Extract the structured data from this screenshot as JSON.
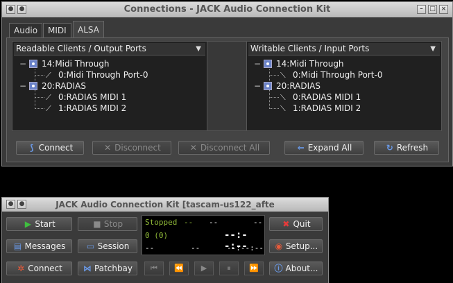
{
  "connections_window": {
    "title": "Connections - JACK Audio Connection Kit",
    "tabs": [
      {
        "label": "Audio"
      },
      {
        "label": "MIDI"
      },
      {
        "label": "ALSA"
      }
    ],
    "readable": {
      "header": "Readable Clients / Output Ports",
      "clients": [
        {
          "label": "14:Midi Through",
          "ports": [
            "0:Midi Through Port-0"
          ]
        },
        {
          "label": "20:RADIAS",
          "ports": [
            "0:RADIAS MIDI 1",
            "1:RADIAS MIDI 2"
          ]
        }
      ]
    },
    "writable": {
      "header": "Writable Clients / Input Ports",
      "clients": [
        {
          "label": "14:Midi Through",
          "ports": [
            "0:Midi Through Port-0"
          ]
        },
        {
          "label": "20:RADIAS",
          "ports": [
            "0:RADIAS MIDI 1",
            "1:RADIAS MIDI 2"
          ]
        }
      ]
    },
    "buttons": {
      "connect": "Connect",
      "disconnect": "Disconnect",
      "disconnect_all": "Disconnect All",
      "expand_all": "Expand All",
      "refresh": "Refresh"
    }
  },
  "main_window": {
    "title": "JACK Audio Connection Kit [tascam-us122_afte",
    "buttons": {
      "start": "Start",
      "stop": "Stop",
      "quit": "Quit",
      "messages": "Messages",
      "session": "Session",
      "setup": "Setup...",
      "connect": "Connect",
      "patchbay": "Patchbay",
      "about": "About..."
    },
    "display": {
      "status": "Stopped",
      "dash1": "--",
      "dash2": "--",
      "dash3": "--",
      "dsp": "0 (0)",
      "time_big": "--:--:--",
      "dash4": "--",
      "dash5": "--",
      "time_small": "--:--:--"
    }
  },
  "colors": {
    "window_bg": "#3a3a3a",
    "status_green": "#8fb838",
    "accent_blue": "#6a82c8"
  }
}
